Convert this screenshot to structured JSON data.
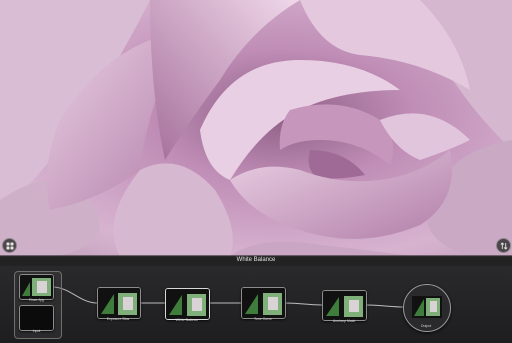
{
  "strip": {
    "title": "White Balance"
  },
  "nodes": [
    {
      "label": "Rose.Jpg"
    },
    {
      "label": "Input"
    },
    {
      "label": "Exposure Bias"
    },
    {
      "label": "White Balance"
    },
    {
      "label": "Tone Curve"
    },
    {
      "label": "Unsharp Mask"
    },
    {
      "label": "Output"
    }
  ],
  "icons": {
    "left": "grid-icon",
    "right": "swap-arrows-icon"
  },
  "colors": {
    "background": "#1a171a",
    "petal": "#c9a3c3",
    "strip": "#262527"
  }
}
